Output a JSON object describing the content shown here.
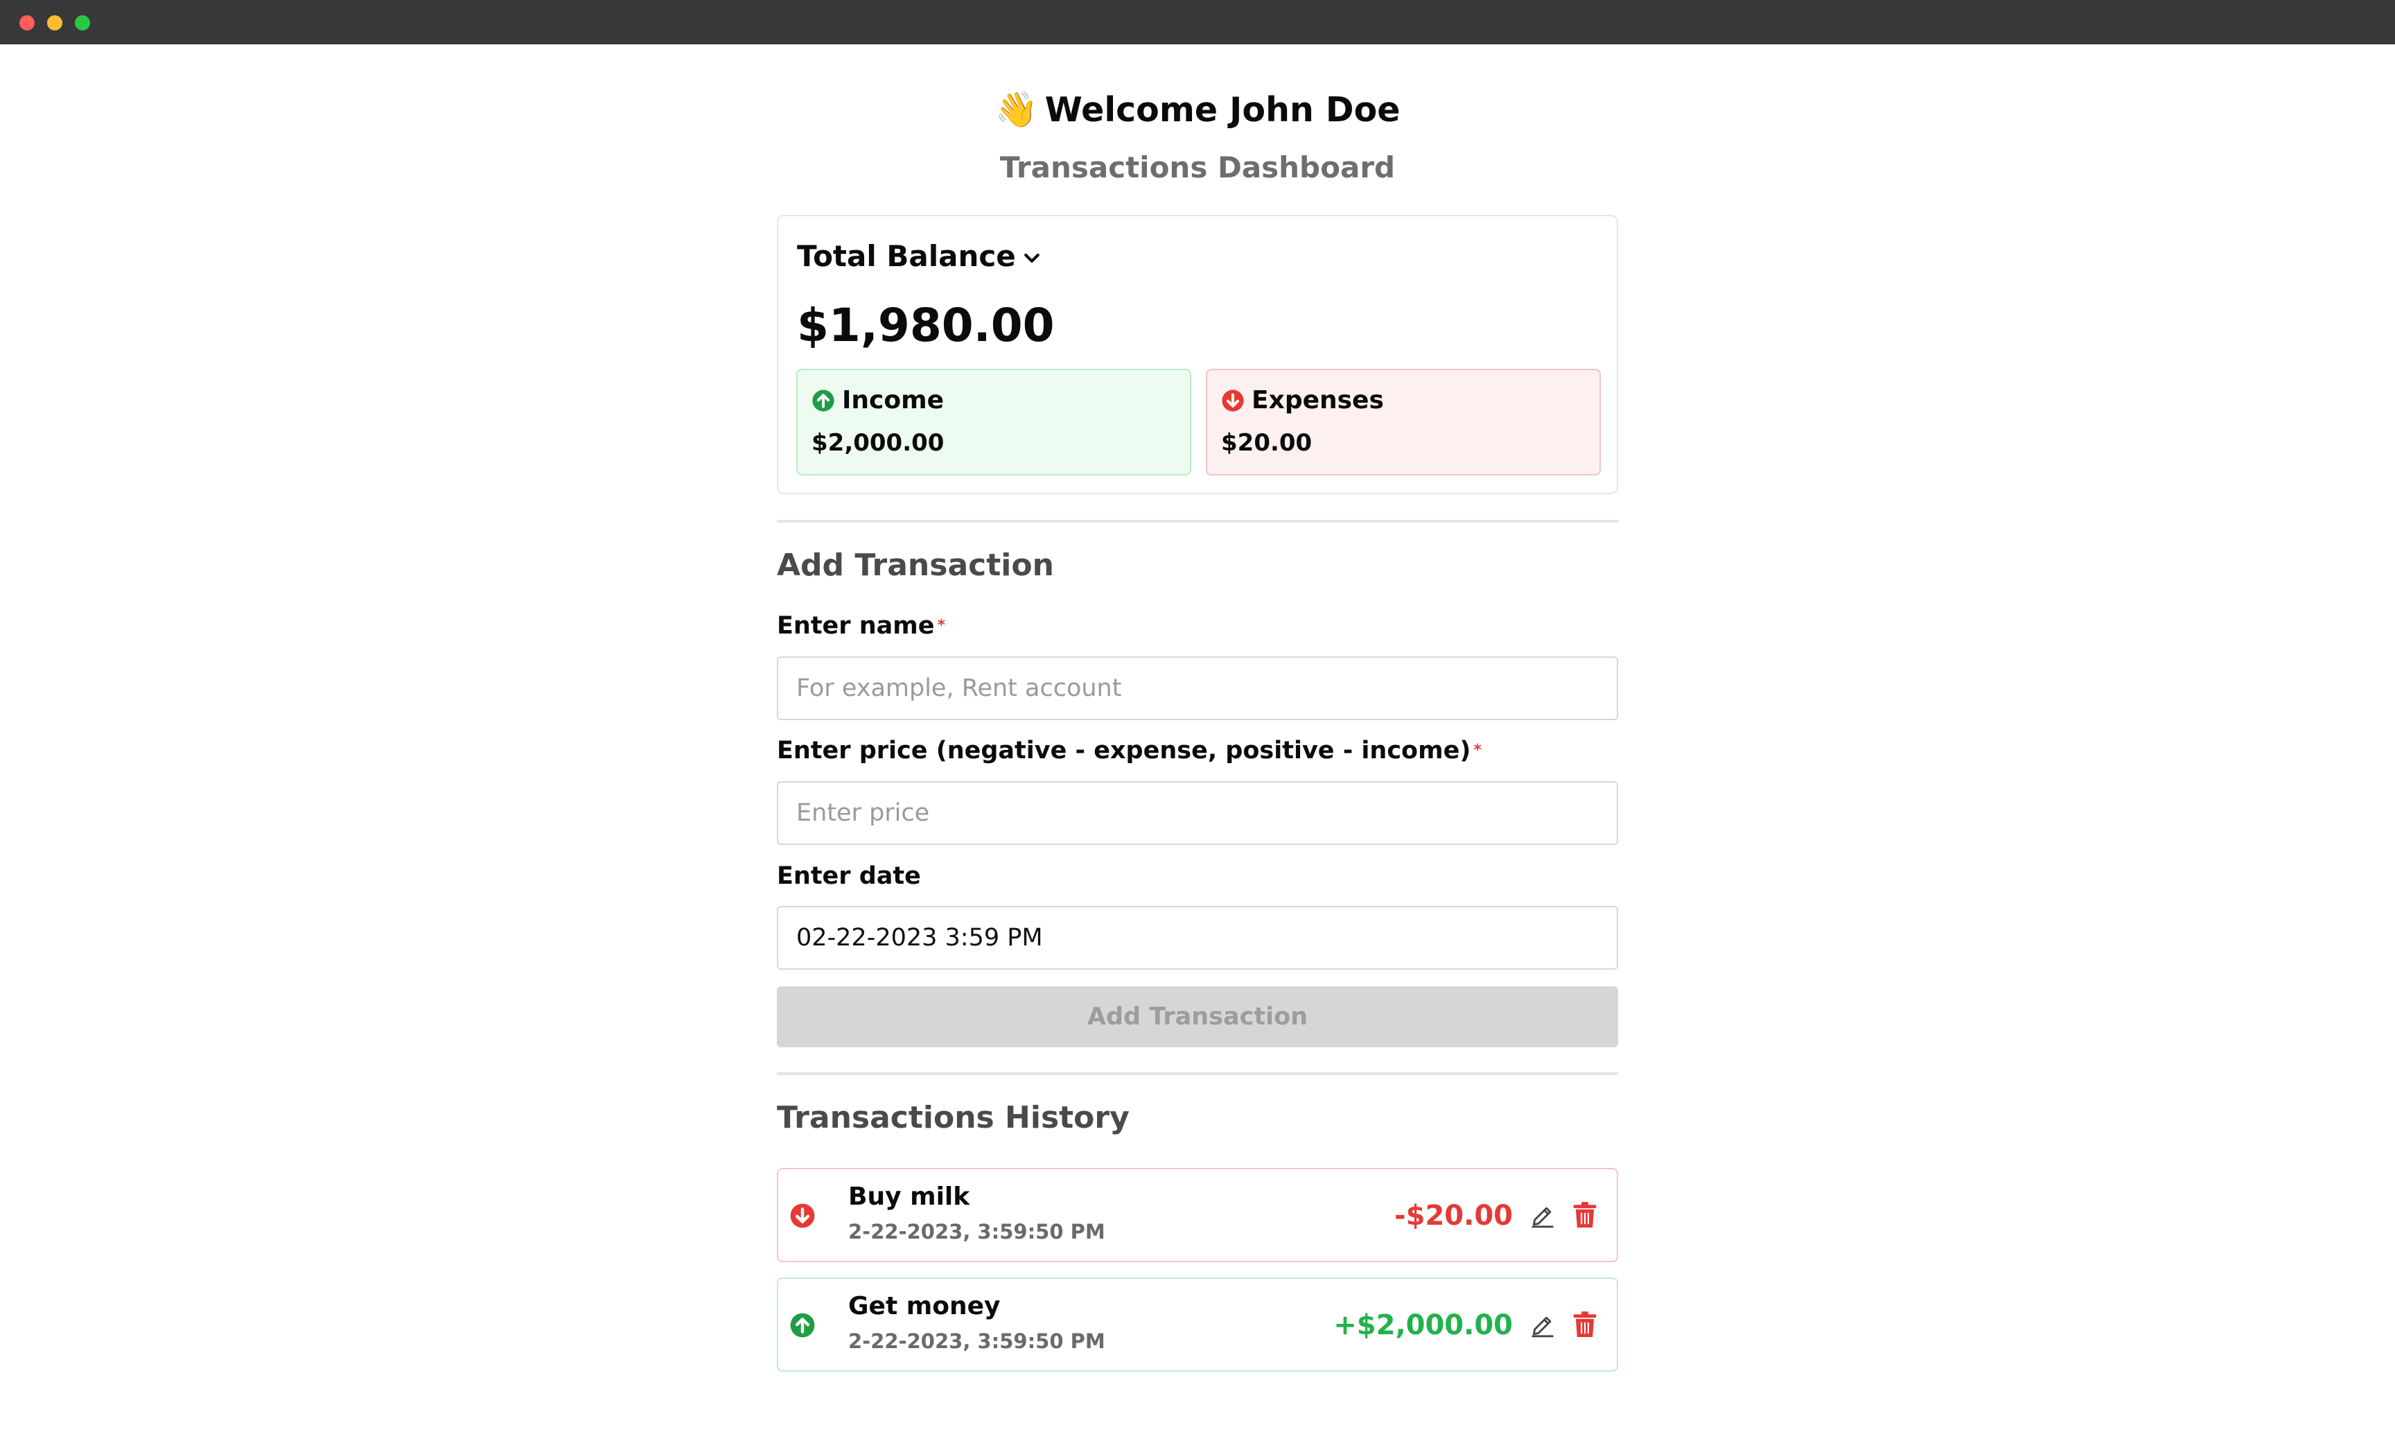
{
  "window": {
    "controls": [
      "close",
      "minimize",
      "maximize"
    ]
  },
  "header": {
    "wave_icon": "waving-hand-icon",
    "welcome": "Welcome John Doe",
    "subtitle": "Transactions Dashboard"
  },
  "balance": {
    "title": "Total Balance",
    "amount": "$1,980.00",
    "income": {
      "label": "Income",
      "value": "$2,000.00",
      "color": "#1f9d45"
    },
    "expenses": {
      "label": "Expenses",
      "value": "$20.00",
      "color": "#e53935"
    }
  },
  "form": {
    "title": "Add Transaction",
    "name_label": "Enter name",
    "name_placeholder": "For example, Rent account",
    "name_value": "",
    "price_label": "Enter price (negative - expense, positive - income)",
    "price_placeholder": "Enter price",
    "price_value": "",
    "date_label": "Enter date",
    "date_value": "02-22-2023 3:59 PM",
    "required_mark": "*",
    "submit_label": "Add Transaction"
  },
  "history": {
    "title": "Transactions History",
    "items": [
      {
        "name": "Buy milk",
        "date": "2-22-2023, 3:59:50 PM",
        "amount": "-$20.00",
        "type": "expense"
      },
      {
        "name": "Get money",
        "date": "2-22-2023, 3:59:50 PM",
        "amount": "+$2,000.00",
        "type": "income"
      }
    ]
  }
}
